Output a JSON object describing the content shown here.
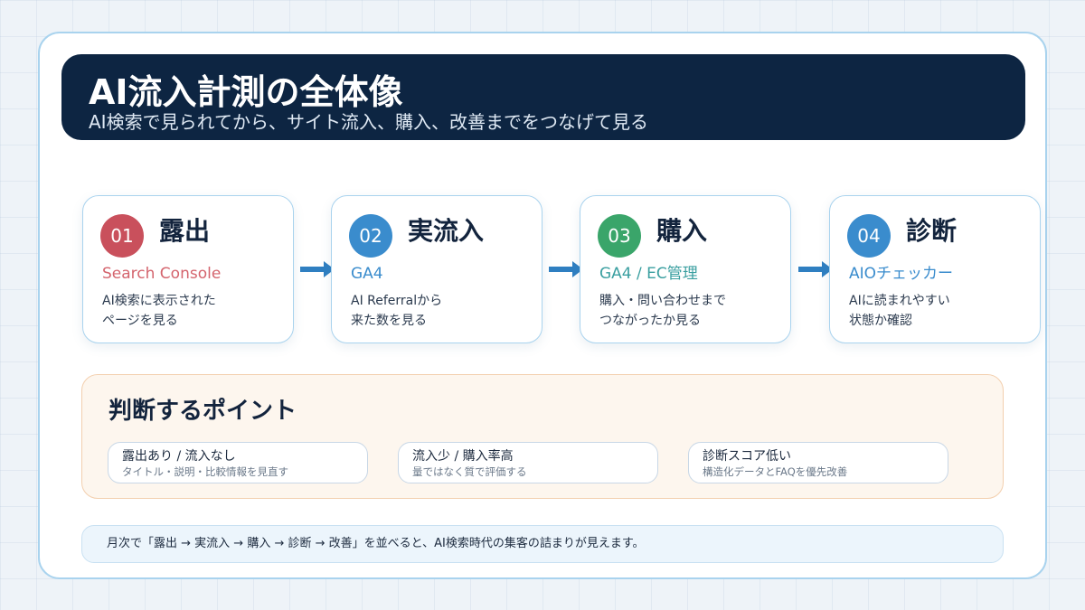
{
  "header": {
    "title": "AI流入計測の全体像",
    "subtitle": "AI検索で見られてから、サイト流入、購入、改善までをつなげて見る"
  },
  "steps": [
    {
      "number": "01",
      "name": "露出",
      "tool": "Search Console",
      "desc_lines": [
        "AI検索に表示された",
        "ページを見る"
      ],
      "accent": "#c9505c",
      "tool_color": "#d4646d"
    },
    {
      "number": "02",
      "name": "実流入",
      "tool": "GA4",
      "desc_lines": [
        "AI Referralから",
        "来た数を見る"
      ],
      "accent": "#3a8ccd",
      "tool_color": "#3a8ccd"
    },
    {
      "number": "03",
      "name": "購入",
      "tool": "GA4 / EC管理",
      "desc_lines": [
        "購入・問い合わせまで",
        "つながったか見る"
      ],
      "accent": "#3aa56a",
      "tool_color": "#3a9fa0"
    },
    {
      "number": "04",
      "name": "診断",
      "tool": "AIOチェッカー",
      "desc_lines": [
        "AIに読まれやすい",
        "状態か確認"
      ],
      "accent": "#3a8ccd",
      "tool_color": "#3a8ccd"
    }
  ],
  "arrow_color": "#2f7fc1",
  "points": {
    "title": "判断するポイント",
    "items": [
      {
        "head": "露出あり / 流入なし",
        "sub": "タイトル・説明・比較情報を見直す"
      },
      {
        "head": "流入少 / 購入率高",
        "sub": "量ではなく質で評価する"
      },
      {
        "head": "診断スコア低い",
        "sub": "構造化データとFAQを優先改善"
      }
    ]
  },
  "footer": {
    "text": "月次で「露出 → 実流入 → 購入 → 診断 → 改善」を並べると、AI検索時代の集客の詰まりが見えます。"
  }
}
